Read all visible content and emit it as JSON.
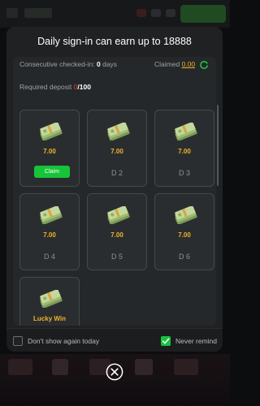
{
  "modal": {
    "title": "Daily sign-in can earn up to 18888",
    "consecutive_label": "Consecutive checked-in:",
    "consecutive_days": "0",
    "days_unit": "days",
    "claimed_label": "Claimed",
    "claimed_amount": "0.00",
    "deposit_label": "Required deposit",
    "deposit_current": "0",
    "deposit_required": "/100",
    "cards": [
      {
        "amount": "7.00",
        "action": "Claim"
      },
      {
        "amount": "7.00",
        "day": "D 2"
      },
      {
        "amount": "7.00",
        "day": "D 3"
      },
      {
        "amount": "7.00",
        "day": "D 4"
      },
      {
        "amount": "7.00",
        "day": "D 5"
      },
      {
        "amount": "7.00",
        "day": "D 6"
      },
      {
        "amount": "Lucky Win"
      }
    ],
    "dont_show_label": "Don't show again today",
    "never_remind_label": "Never remind",
    "never_remind_checked": true
  },
  "colors": {
    "accent_gold": "#f0b429",
    "claim_green": "#16c43a",
    "deposit_red": "#e23c3c"
  },
  "icons": [
    "refresh-icon",
    "money-bill-icon",
    "checkbox-check-icon",
    "close-icon"
  ]
}
